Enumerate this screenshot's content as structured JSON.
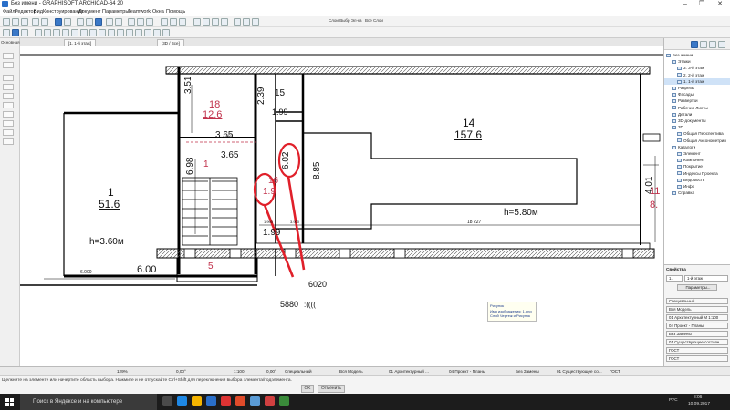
{
  "window": {
    "title": "Без имени - GRAPHISOFT ARCHICAD-64 20",
    "minimize": "–",
    "maximize": "❐",
    "close": "✕"
  },
  "menu": [
    "Файл",
    "Редактор",
    "Вид",
    "Конструирование",
    "Документ",
    "Параметры",
    "Teamwork",
    "Окна",
    "Помощь"
  ],
  "toolbar": {
    "layer_combo_label": "Слои Выбр Эл-ка",
    "renovation_label": "Все Слои"
  },
  "toolbox": {
    "header": "Основная"
  },
  "tabs": [
    {
      "label": "[1. 1-й этаж]"
    },
    {
      "label": "[3D / Все]"
    }
  ],
  "plan": {
    "rooms": [
      {
        "id": "18",
        "area": "12.6"
      },
      {
        "id": "15",
        "area": "1.99"
      },
      {
        "id": "14",
        "area": "157.6"
      },
      {
        "id": "1",
        "area": "51.6"
      },
      {
        "id": "16",
        "area": "1.9"
      },
      {
        "id": "11",
        "area": "8."
      }
    ],
    "dimensions": [
      "3.51",
      "2.39",
      "3.65",
      "6.98",
      "3.65",
      "6.02",
      "8.85",
      "1.99",
      "6.00",
      "4.01"
    ],
    "heights": [
      "h=3.60м",
      "h=5.80м"
    ],
    "room_marker": "5",
    "room_marker_1": "1",
    "small_dims": [
      "6.000",
      "4.000",
      "18 227",
      "1.990",
      "3.900"
    ],
    "annotations": {
      "top_value": "6020",
      "bottom_value": "5880",
      "emoticon": ":(((("
    },
    "tooltip": {
      "title": "Рисунок",
      "line1": "Имя изображения: 1.png",
      "line2": "Слой Чертеж и Рисунок"
    }
  },
  "navigator": {
    "items": [
      {
        "label": "Без имени",
        "level": 0
      },
      {
        "label": "Этажи",
        "level": 1
      },
      {
        "label": "3. 3-й этаж",
        "level": 2
      },
      {
        "label": "2. 2-й этаж",
        "level": 2
      },
      {
        "label": "1. 1-й этаж",
        "level": 2,
        "selected": true
      },
      {
        "label": "Разрезы",
        "level": 1
      },
      {
        "label": "Фасады",
        "level": 1
      },
      {
        "label": "Развертки",
        "level": 1
      },
      {
        "label": "Рабочие Листы",
        "level": 1
      },
      {
        "label": "Детали",
        "level": 1
      },
      {
        "label": "3D-документы",
        "level": 1
      },
      {
        "label": "3D",
        "level": 1
      },
      {
        "label": "Общая Перспектива",
        "level": 2
      },
      {
        "label": "Общая Аксонометрия",
        "level": 2
      },
      {
        "label": "Каталоги",
        "level": 1
      },
      {
        "label": "Элемент",
        "level": 2
      },
      {
        "label": "Компонент",
        "level": 2
      },
      {
        "label": "Покрытие",
        "level": 2
      },
      {
        "label": "Индексы Проекта",
        "level": 2
      },
      {
        "label": "Ведомость",
        "level": 2
      },
      {
        "label": "Инфо",
        "level": 2
      },
      {
        "label": "Справка",
        "level": 1
      }
    ]
  },
  "properties": {
    "header": "Свойства",
    "story_num": "1.",
    "story_name": "1-й этаж",
    "params_button": "Параметры...",
    "list": [
      "Специальный",
      "Вся Модель",
      "01 Архитектурный М 1:100",
      "04 Проект - Планы",
      "Без Замены",
      "01 Существующее состоян...",
      "ГОСТ",
      "ГОСТ"
    ]
  },
  "statusbar": {
    "zoom": "129%",
    "angle": "0,00°",
    "scale": "1:100",
    "angle2": "0,00°",
    "mode": "Специальный",
    "model": "Вся Модель",
    "layer": "01 Архитектурный ...",
    "pen": "04 Проект - Планы",
    "renovation": "Без Замены",
    "state": "01 Существующее со...",
    "standard": "ГОСТ"
  },
  "hint": {
    "text": "Щелкните на элементе или начертите область выбора. Нажмите и не отпускайте Ctrl+Shift для переключения выбора элемента/подэлемента.",
    "ok": "OK",
    "cancel": "Отменить"
  },
  "taskbar": {
    "search_placeholder": "Поиск в Яндексе и на компьютере",
    "lang": "РУС",
    "time": "8:06",
    "date": "10.09.2017"
  },
  "colors": {
    "room_red": "#c0304a",
    "annotation_red": "#e0202a",
    "accent_blue": "#3b78c7"
  }
}
